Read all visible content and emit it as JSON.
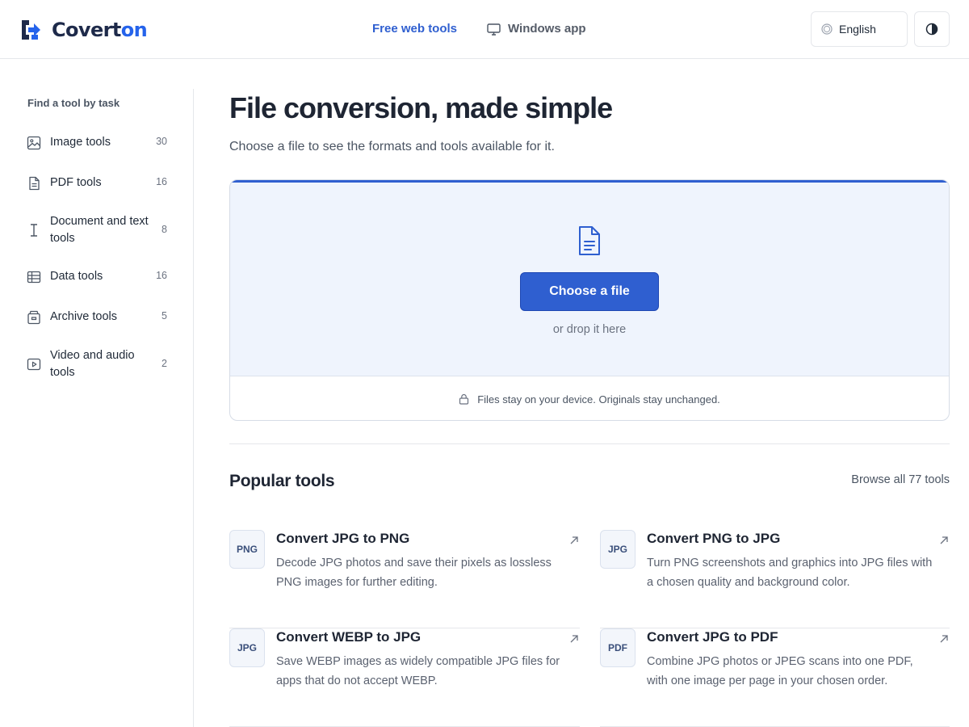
{
  "header": {
    "brand_prefix": "Covert",
    "brand_suffix": "on",
    "nav_free_tools": "Free web tools",
    "nav_windows_app": "Windows app",
    "language": "English",
    "icons": {
      "logo": "arrow-into-box-logo",
      "windows": "monitor-icon",
      "language": "globe-icon",
      "theme": "contrast-icon"
    },
    "colors": {
      "brand_dark": "#1e2a4a",
      "accent": "#2563eb"
    }
  },
  "sidebar": {
    "title": "Find a tool by task",
    "items": [
      {
        "label": "Image tools",
        "count": "30",
        "icon": "image-icon"
      },
      {
        "label": "PDF tools",
        "count": "16",
        "icon": "file-icon"
      },
      {
        "label": "Document and text tools",
        "count": "8",
        "icon": "text-cursor-icon"
      },
      {
        "label": "Data tools",
        "count": "16",
        "icon": "table-icon"
      },
      {
        "label": "Archive tools",
        "count": "5",
        "icon": "archive-icon"
      },
      {
        "label": "Video and audio tools",
        "count": "2",
        "icon": "play-icon"
      }
    ]
  },
  "main": {
    "title": "File conversion, made simple",
    "subtitle": "Choose a file to see the formats and tools available for it.",
    "dropzone": {
      "button_label": "Choose a file",
      "hint": "or drop it here",
      "privacy_note": "Files stay on your device. Originals stay unchanged.",
      "colors": {
        "background": "#eff4fd",
        "button": "#2f5fd0"
      }
    },
    "popular": {
      "title": "Popular tools",
      "browse_all": "Browse all 77 tools",
      "tools": [
        {
          "badge": "PNG",
          "name": "Convert JPG to PNG",
          "description": "Decode JPG photos and save their pixels as lossless PNG images for further editing."
        },
        {
          "badge": "JPG",
          "name": "Convert PNG to JPG",
          "description": "Turn PNG screenshots and graphics into JPG files with a chosen quality and background color."
        },
        {
          "badge": "JPG",
          "name": "Convert WEBP to JPG",
          "description": "Save WEBP images as widely compatible JPG files for apps that do not accept WEBP."
        },
        {
          "badge": "PDF",
          "name": "Convert JPG to PDF",
          "description": "Combine JPG photos or JPEG scans into one PDF, with one image per page in your chosen order."
        }
      ]
    }
  }
}
